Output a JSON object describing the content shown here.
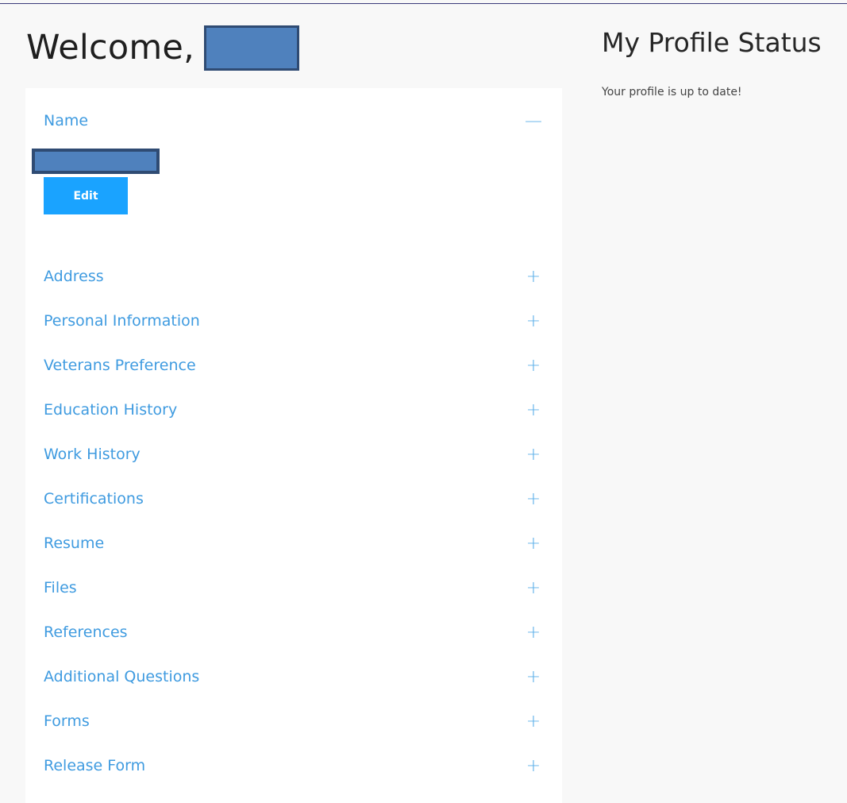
{
  "welcome": {
    "greeting": "Welcome,"
  },
  "sections": [
    {
      "label": "Name",
      "toggle": "—"
    },
    {
      "label": "Address",
      "toggle": "+"
    },
    {
      "label": "Personal Information",
      "toggle": "+"
    },
    {
      "label": "Veterans Preference",
      "toggle": "+"
    },
    {
      "label": "Education History",
      "toggle": "+"
    },
    {
      "label": "Work History",
      "toggle": "+"
    },
    {
      "label": "Certifications",
      "toggle": "+"
    },
    {
      "label": "Resume",
      "toggle": "+"
    },
    {
      "label": "Files",
      "toggle": "+"
    },
    {
      "label": "References",
      "toggle": "+"
    },
    {
      "label": "Additional Questions",
      "toggle": "+"
    },
    {
      "label": "Forms",
      "toggle": "+"
    },
    {
      "label": "Release Form",
      "toggle": "+"
    }
  ],
  "name_section": {
    "edit_label": "Edit"
  },
  "status": {
    "title": "My Profile Status",
    "message": "Your profile is up to date!"
  },
  "colors": {
    "accent": "#1aa3ff",
    "link": "#3f9be0",
    "redaction": "#4f81bd"
  }
}
